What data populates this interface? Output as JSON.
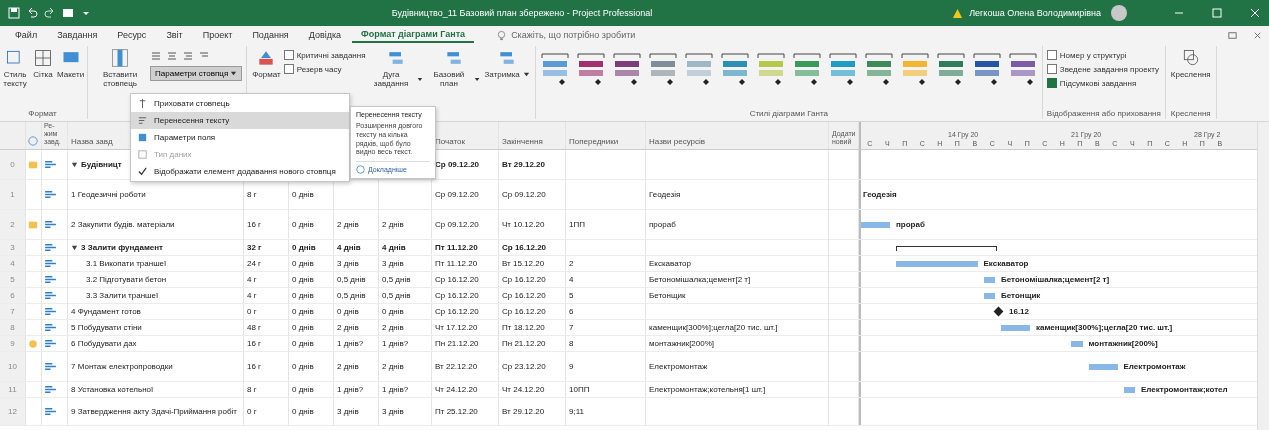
{
  "window": {
    "title": "Будівництво_11 Базовий план збережено - Project Professional",
    "user": "Легкоша Олена Володимирівна"
  },
  "tabs": [
    {
      "label": "Файл",
      "selected": false
    },
    {
      "label": "Завдання",
      "selected": false
    },
    {
      "label": "Ресурс",
      "selected": false
    },
    {
      "label": "Звіт",
      "selected": false
    },
    {
      "label": "Проект",
      "selected": false
    },
    {
      "label": "Подання",
      "selected": false
    },
    {
      "label": "Довідка",
      "selected": false
    },
    {
      "label": "Формат діаграми Ганта",
      "selected": true
    }
  ],
  "search": {
    "placeholder": "Скажіть, що потрібно зробити"
  },
  "ribbon": {
    "format_buttons": [
      "Стиль тексту",
      "Сітка",
      "Макети"
    ],
    "format_group": "Формат",
    "insert_column": "Вставити стовпець",
    "column_settings": "Параметри стовпця",
    "format_button": "Формат",
    "bar_checks": [
      {
        "label": "Критичні завдання",
        "checked": false
      },
      {
        "label": "Резерв часу",
        "checked": false
      }
    ],
    "bar_buttons": [
      "Дуга завдання",
      "Базовий план",
      "Затримка"
    ],
    "gantt_styles": [
      {
        "color": "#5b9bd5"
      },
      {
        "color": "#a0306e"
      },
      {
        "color": "#7a3e7a"
      },
      {
        "color": "#7f8c99"
      },
      {
        "color": "#9fb8c8"
      },
      {
        "color": "#2e8fb5"
      },
      {
        "color": "#b5c84a"
      },
      {
        "color": "#3a9a5c"
      },
      {
        "color": "#1f9cc4"
      },
      {
        "color": "#3d8a5a"
      },
      {
        "color": "#f2b632"
      },
      {
        "color": "#2f7d5b"
      },
      {
        "color": "#2456a6"
      },
      {
        "color": "#7b5aa6"
      }
    ],
    "styles_group": "Стилі діаграми Ганта",
    "show_checks": [
      {
        "label": "Номер у структурі",
        "checked": false
      },
      {
        "label": "Зведене завдання проекту",
        "checked": false
      },
      {
        "label": "Підсумкові завдання",
        "checked": true
      }
    ],
    "show_group": "Відображення або приховання",
    "drawing_button": "Креслення",
    "drawing_group": "Креслення"
  },
  "menu": [
    {
      "label": "Приховати стовпець",
      "selected": false,
      "disabled": false,
      "kind": "hide"
    },
    {
      "label": "Перенесення тексту",
      "selected": true,
      "disabled": false,
      "kind": "wrap"
    },
    {
      "label": "Параметри поля",
      "selected": false,
      "disabled": false,
      "kind": "field"
    },
    {
      "label": "Тип даних",
      "selected": false,
      "disabled": true,
      "kind": "type"
    },
    {
      "label": "Відображати елемент додавання нового стовпця",
      "selected": false,
      "disabled": false,
      "checked": true,
      "kind": "check"
    }
  ],
  "tooltip": {
    "title": "Перенесення тексту",
    "body": "Розширення довгого тексту на кілька рядків, щоб було видно весь текст.",
    "link": "Докладніше"
  },
  "table": {
    "columns": {
      "mode": "Ре-жим завд.",
      "name": "Назва завд",
      "start": "Початок",
      "finish": "Закінчення",
      "predecessors": "Попередники",
      "resources": "Назви ресурсів",
      "add": "Додати новий"
    },
    "rows": [
      {
        "id": "0",
        "kind": "note",
        "summary": true,
        "name": "Будівницт",
        "start": "Ср 09.12.20",
        "finish": "Вт 29.12.20"
      },
      {
        "id": "1",
        "kind": "plain",
        "summary": false,
        "name": "1 Геодезичні роботи",
        "column_5": "8 г",
        "column_6": "0 днів",
        "start": "Ср 09.12.20",
        "finish": "Ср 09.12.20",
        "resources": "Геодезія"
      },
      {
        "id": "2",
        "kind": "note",
        "summary": false,
        "name": "2 Закупити будів. матеріали",
        "column_5": "16 г",
        "column_6": "0 днів",
        "column_7": "2 днів",
        "column_8": "2 днів",
        "start": "Ср 09.12.20",
        "finish": "Чт 10.12.20",
        "predecessors": "1ПП",
        "resources": "прораб"
      },
      {
        "id": "3",
        "kind": "plain",
        "summary": true,
        "name": "3 Залити фундамент",
        "column_5": "32 г",
        "column_6": "0 днів",
        "column_7": "4 днів",
        "column_8": "4 днів",
        "start": "Пт 11.12.20",
        "finish": "Ср 16.12.20"
      },
      {
        "id": "4",
        "kind": "plain",
        "summary": false,
        "name": "3.1 Викопати траншеї",
        "column_5": "24 г",
        "column_6": "0 днів",
        "column_7": "3 днів",
        "column_8": "3 днів",
        "start": "Пт 11.12.20",
        "finish": "Вт 15.12.20",
        "predecessors": "2",
        "resources": "Екскаватор"
      },
      {
        "id": "5",
        "kind": "plain",
        "summary": false,
        "name": "3.2 Підготувати бетон",
        "column_5": "4 г",
        "column_6": "0 днів",
        "column_7": "0,5 днів",
        "column_8": "0,5 днів",
        "start": "Ср 16.12.20",
        "finish": "Ср 16.12.20",
        "predecessors": "4",
        "resources": "Бетономішалка;цемент[2 т]"
      },
      {
        "id": "6",
        "kind": "plain",
        "summary": false,
        "name": "3.3 Залити траншеї",
        "column_5": "4 г",
        "column_6": "0 днів",
        "column_7": "0,5 днів",
        "column_8": "0,5 днів",
        "start": "Ср 16.12.20",
        "finish": "Ср 16.12.20",
        "predecessors": "5",
        "resources": "Бетонщик"
      },
      {
        "id": "7",
        "kind": "plain",
        "summary": false,
        "name": "4 Фундамент готов",
        "column_5": "0 г",
        "column_6": "0 днів",
        "column_7": "0 днів",
        "column_8": "0 днів",
        "start": "Ср 16.12.20",
        "finish": "Ср 16.12.20",
        "predecessors": "6"
      },
      {
        "id": "8",
        "kind": "plain",
        "summary": false,
        "name": "5 Побудувати стіни",
        "column_5": "48 г",
        "column_6": "0 днів",
        "column_7": "2 днів",
        "column_8": "2 днів",
        "start": "Чт 17.12.20",
        "finish": "Пт 18.12.20",
        "predecessors": "7",
        "resources": "каменщик[300%];цегла[20 тис. шт.]"
      },
      {
        "id": "9",
        "kind": "alert",
        "summary": false,
        "name": "6 Побудувати дах",
        "column_5": "16 г",
        "column_6": "0 днів",
        "column_7": "1 днів?",
        "column_8": "1 днів?",
        "start": "Пн 21.12.20",
        "finish": "Пн 21.12.20",
        "predecessors": "8",
        "resources": "монтажник[200%]"
      },
      {
        "id": "10",
        "kind": "plain",
        "summary": false,
        "name": "7 Монтаж електропроводки",
        "column_5": "16 г",
        "column_6": "0 днів",
        "column_7": "2 днів",
        "column_8": "2 днів",
        "start": "Вт 22.12.20",
        "finish": "Ср 23.12.20",
        "predecessors": "9",
        "resources": "Електромонтаж"
      },
      {
        "id": "11",
        "kind": "plain",
        "summary": false,
        "name": "8 Установка котельної",
        "column_5": "8 г",
        "column_6": "0 днів",
        "column_7": "1 днів?",
        "column_8": "1 днів?",
        "start": "Чт 24.12.20",
        "finish": "Чт 24.12.20",
        "predecessors": "10ПП",
        "resources": "Електромонтаж;котельня[1 шт.]"
      },
      {
        "id": "12",
        "kind": "plain",
        "summary": false,
        "name": "9 Затвердження акту Здачі-Приймання робіт",
        "column_5": "0 г",
        "column_6": "0 днів",
        "column_7": "3 днів",
        "column_8": "3 днів",
        "start": "Пт 25.12.20",
        "finish": "Вт 29.12.20",
        "predecessors": "9;11"
      }
    ]
  },
  "gantt": {
    "weeks": [
      "14 Гру 20",
      "21 Гру 20",
      "28 Гру 2"
    ],
    "days": [
      "С",
      "Ч",
      "П",
      "С",
      "Н",
      "П",
      "В",
      "С",
      "Ч",
      "П",
      "С",
      "Н",
      "П",
      "В",
      "С",
      "Ч",
      "П",
      "С",
      "Н",
      "П",
      "В"
    ],
    "bars": [
      {
        "kind": "none"
      },
      {
        "kind": "label",
        "label": "Геодезія"
      },
      {
        "kind": "task",
        "label": "прораб"
      },
      {
        "kind": "summary"
      },
      {
        "kind": "task",
        "label": "Екскаватор"
      },
      {
        "kind": "task",
        "label": "Бетономішалка;цемент[2 т]"
      },
      {
        "kind": "task",
        "label": "Бетонщик"
      },
      {
        "kind": "milestone",
        "label": "16.12"
      },
      {
        "kind": "task",
        "label": "каменщик[300%];цегла[20 тис. шт.]"
      },
      {
        "kind": "task",
        "label": "монтажник[200%]"
      },
      {
        "kind": "task",
        "label": "Електромонтаж"
      },
      {
        "kind": "task",
        "label": "Електромонтаж;котел"
      },
      {
        "kind": "none"
      }
    ]
  }
}
